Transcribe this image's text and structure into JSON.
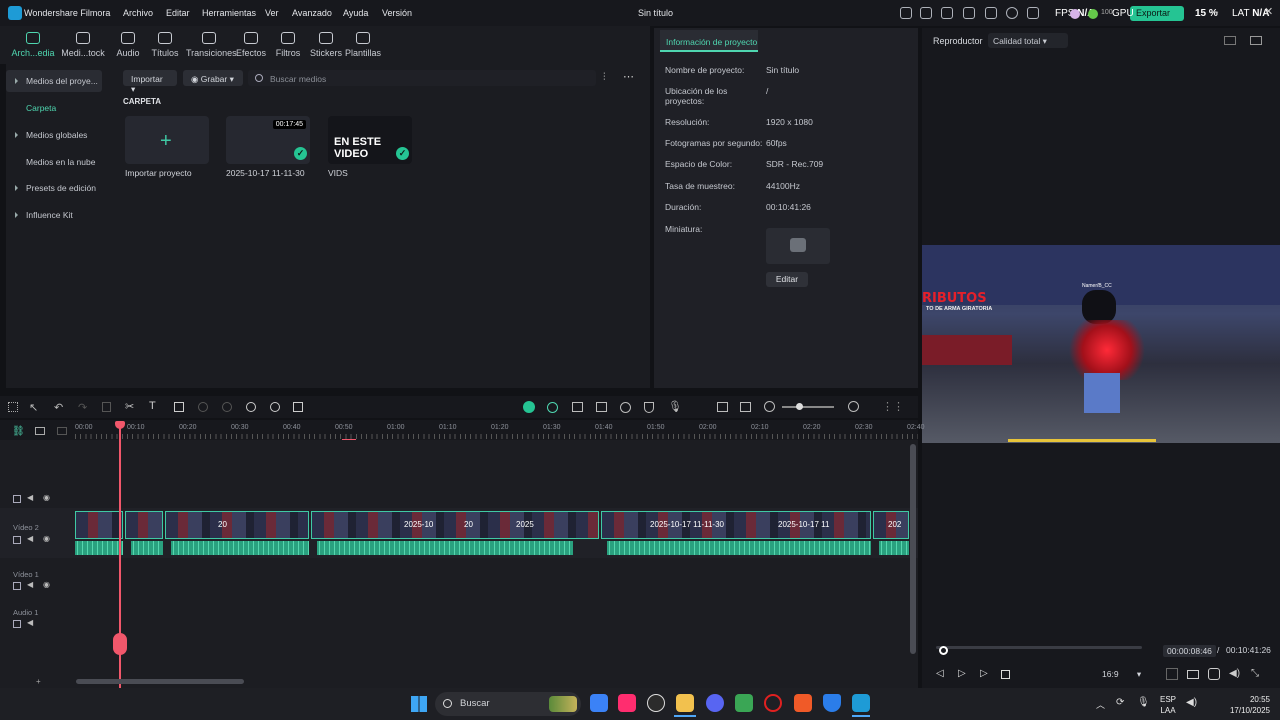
{
  "app": {
    "name": "Wondershare Filmora",
    "project_title": "Sin título"
  },
  "menu": [
    "Archivo",
    "Editar",
    "Herramientas",
    "Ver",
    "Avanzado",
    "Ayuda",
    "Versión"
  ],
  "header": {
    "fps_label": "FPS",
    "fps_value": "N/A",
    "gpu_label": "GPU",
    "gpu_value": "15 %",
    "lat_label": "LAT",
    "lat_value": "N/A",
    "credits": "100",
    "export_label": "Exportar"
  },
  "toolbar": [
    {
      "label": "Arch...edia",
      "icon": "media-icon",
      "active": true
    },
    {
      "label": "Medi...tock",
      "icon": "stock-icon"
    },
    {
      "label": "Audio",
      "icon": "music-note-icon"
    },
    {
      "label": "Títulos",
      "icon": "text-icon"
    },
    {
      "label": "Transiciones",
      "icon": "transition-icon"
    },
    {
      "label": "Efectos",
      "icon": "sparkle-icon"
    },
    {
      "label": "Filtros",
      "icon": "filter-icon"
    },
    {
      "label": "Stickers",
      "icon": "sticker-icon"
    },
    {
      "label": "Plantillas",
      "icon": "template-icon"
    }
  ],
  "sidebar": [
    {
      "label": "Medios del proye...",
      "expandable": true
    },
    {
      "label": "Carpeta",
      "selected": true
    },
    {
      "label": "Medios globales",
      "expandable": true
    },
    {
      "label": "Medios en la nube"
    },
    {
      "label": "Presets de edición",
      "expandable": true
    },
    {
      "label": "Influence Kit",
      "expandable": true
    }
  ],
  "media": {
    "import_label": "Importar",
    "record_label": "Grabar",
    "search_placeholder": "Buscar medios",
    "folder_label": "CARPETA",
    "items": [
      {
        "caption": "Importar proyecto"
      },
      {
        "caption": "2025-10-17 11-11-30",
        "duration": "00:17:45"
      },
      {
        "caption": "VIDS",
        "thumb_text": "EN ESTE VIDEO"
      }
    ]
  },
  "project_info": {
    "tab": "Información de proyecto",
    "rows": [
      {
        "label": "Nombre de proyecto:",
        "value": "Sin título"
      },
      {
        "label": "Ubicación de los proyectos:",
        "value": "/"
      },
      {
        "label": "Resolución:",
        "value": "1920 x 1080"
      },
      {
        "label": "Fotogramas por segundo:",
        "value": "60fps"
      },
      {
        "label": "Espacio de Color:",
        "value": "SDR - Rec.709"
      },
      {
        "label": "Tasa de muestreo:",
        "value": "44100Hz"
      },
      {
        "label": "Duración:",
        "value": "00:10:41:26"
      },
      {
        "label": "Miniatura:",
        "value": ""
      }
    ],
    "edit_label": "Editar"
  },
  "player": {
    "label": "Reproductor",
    "quality": "Calidad total",
    "preview_title": "RIBUTOS",
    "preview_subtitle": "TO DE ARMA GIRATORIA",
    "preview_nametag": "Namer/B_CC",
    "current_time": "00:00:08:46",
    "separator": "/",
    "total_time": "00:10:41:26",
    "aspect": "16:9",
    "progress": 0.013
  },
  "timeline": {
    "ruler": [
      "00:00",
      "00:10",
      "00:20",
      "00:30",
      "00:40",
      "00:50",
      "01:00",
      "01:10",
      "01:20",
      "01:30",
      "01:40",
      "01:50",
      "02:00",
      "02:10",
      "02:20",
      "02:30",
      "02:40"
    ],
    "tracks": [
      {
        "name": ""
      },
      {
        "name": "Vídeo 2"
      },
      {
        "name": "Vídeo 1"
      },
      {
        "name": "Audio 1"
      }
    ],
    "clip_labels": [
      "20",
      "2025-10",
      "20",
      "2025",
      "2025-10-17 11-11-30",
      "2025-10-17 11",
      "202"
    ]
  },
  "taskbar": {
    "search": "Buscar",
    "lang_top": "ESP",
    "lang_bottom": "LAA",
    "time": "20:55",
    "date": "17/10/2025"
  }
}
